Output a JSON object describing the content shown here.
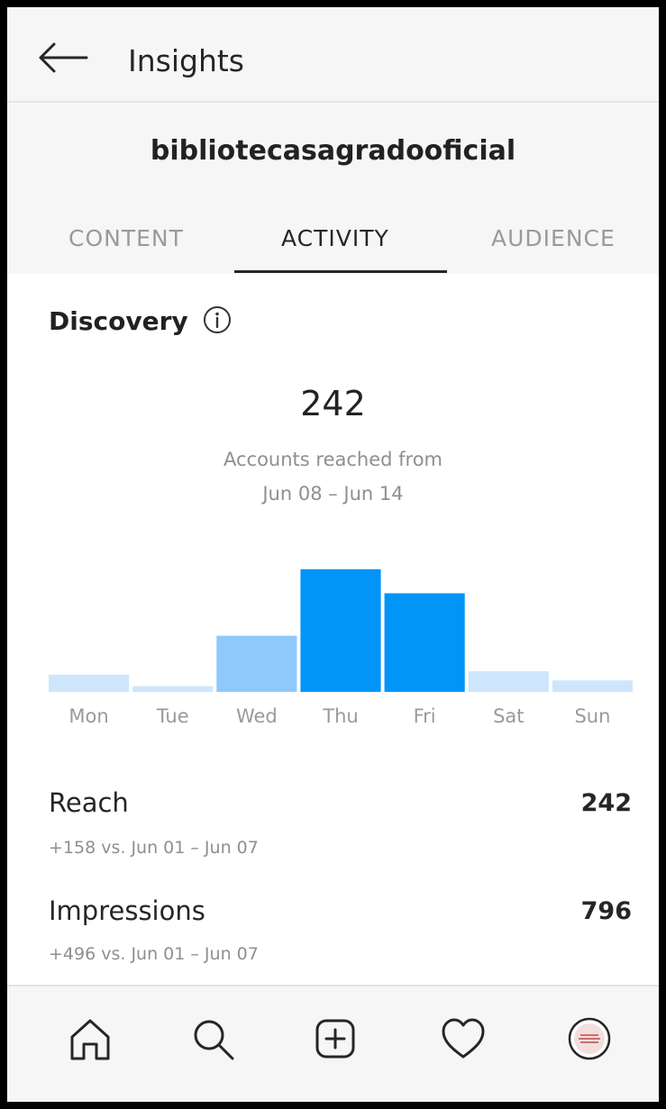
{
  "header": {
    "title": "Insights",
    "back_icon": "back-arrow-icon"
  },
  "profile": {
    "username": "bibliotecasagradooficial"
  },
  "tabs": [
    {
      "label": "CONTENT",
      "active": false
    },
    {
      "label": "ACTIVITY",
      "active": true
    },
    {
      "label": "AUDIENCE",
      "active": false
    }
  ],
  "discovery": {
    "title": "Discovery",
    "info_icon": "info-icon",
    "total": "242",
    "caption_line1": "Accounts reached from",
    "caption_line2": "Jun 08 – Jun 14"
  },
  "chart_data": {
    "type": "bar",
    "categories": [
      "Mon",
      "Tue",
      "Wed",
      "Thu",
      "Fri",
      "Sat",
      "Sun"
    ],
    "values": [
      15,
      5,
      49,
      107,
      86,
      18,
      10
    ],
    "ylim": [
      0,
      110
    ],
    "grid": false,
    "colors": {
      "high": "#0095f6",
      "medium": "#8fc9fb",
      "low": "#cde6fd"
    }
  },
  "metrics": [
    {
      "label": "Reach",
      "value": "242",
      "comparison": "+158 vs. Jun 01 – Jun 07"
    },
    {
      "label": "Impressions",
      "value": "796",
      "comparison": "+496 vs. Jun 01 – Jun 07"
    }
  ],
  "bottom_nav": [
    {
      "name": "home-icon"
    },
    {
      "name": "search-icon"
    },
    {
      "name": "add-post-icon"
    },
    {
      "name": "activity-heart-icon"
    },
    {
      "name": "profile-avatar-icon"
    }
  ]
}
